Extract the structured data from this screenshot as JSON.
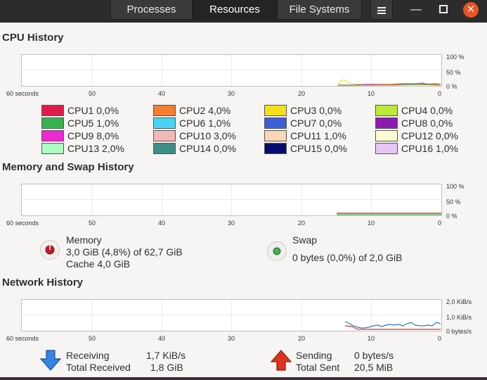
{
  "tabs": [
    "Processes",
    "Resources",
    "File Systems"
  ],
  "cpu": {
    "title": "CPU History",
    "y_labels": [
      "100 %",
      "50 %",
      "0 %"
    ],
    "x_labels": [
      "60 seconds",
      "50",
      "40",
      "30",
      "20",
      "10",
      "0"
    ],
    "cores": [
      {
        "label": "CPU1",
        "value": "0,0%",
        "color": "#e01b4c"
      },
      {
        "label": "CPU2",
        "value": "4,0%",
        "color": "#f57d31"
      },
      {
        "label": "CPU3",
        "value": "0,0%",
        "color": "#f7e01a"
      },
      {
        "label": "CPU4",
        "value": "0,0%",
        "color": "#bdea39"
      },
      {
        "label": "CPU5",
        "value": "1,0%",
        "color": "#36b34c"
      },
      {
        "label": "CPU6",
        "value": "1,0%",
        "color": "#48d5f5"
      },
      {
        "label": "CPU7",
        "value": "0,0%",
        "color": "#3a5fd6"
      },
      {
        "label": "CPU8",
        "value": "0,0%",
        "color": "#8e1bb0"
      },
      {
        "label": "CPU9",
        "value": "8,0%",
        "color": "#ee29d3"
      },
      {
        "label": "CPU10",
        "value": "3,0%",
        "color": "#f5b8b8"
      },
      {
        "label": "CPU11",
        "value": "1,0%",
        "color": "#fcd7b5"
      },
      {
        "label": "CPU12",
        "value": "0,0%",
        "color": "#fdfbd0"
      },
      {
        "label": "CPU13",
        "value": "2,0%",
        "color": "#adfcc4"
      },
      {
        "label": "CPU14",
        "value": "0,0%",
        "color": "#3f8e86"
      },
      {
        "label": "CPU15",
        "value": "0,0%",
        "color": "#070d6e"
      },
      {
        "label": "CPU16",
        "value": "1,0%",
        "color": "#e6c6f5"
      }
    ]
  },
  "memory": {
    "title": "Memory and Swap History",
    "y_labels": [
      "100 %",
      "50 %",
      "0 %"
    ],
    "x_labels": [
      "60 seconds",
      "50",
      "40",
      "30",
      "20",
      "10",
      "0"
    ],
    "memory_label": "Memory",
    "memory_usage": "3,0 GiB (4,8%) of 62,7 GiB",
    "cache": "Cache 4,0 GiB",
    "swap_label": "Swap",
    "swap_usage": "0 bytes (0,0%) of 2,0 GiB",
    "memory_color": "#c01c28",
    "swap_color": "#4caf50"
  },
  "network": {
    "title": "Network History",
    "y_labels": [
      "2,0 KiB/s",
      "1,0 KiB/s",
      "0 bytes/s"
    ],
    "x_labels": [
      "60 seconds",
      "50",
      "40",
      "30",
      "20",
      "10",
      "0"
    ],
    "receiving_label": "Receiving",
    "receiving_value": "1,7 KiB/s",
    "total_received_label": "Total Received",
    "total_received_value": "1,8 GiB",
    "sending_label": "Sending",
    "sending_value": "0 bytes/s",
    "total_sent_label": "Total Sent",
    "total_sent_value": "20,5 MiB",
    "receiving_color": "#2a76c6",
    "sending_color": "#e0331f"
  }
}
